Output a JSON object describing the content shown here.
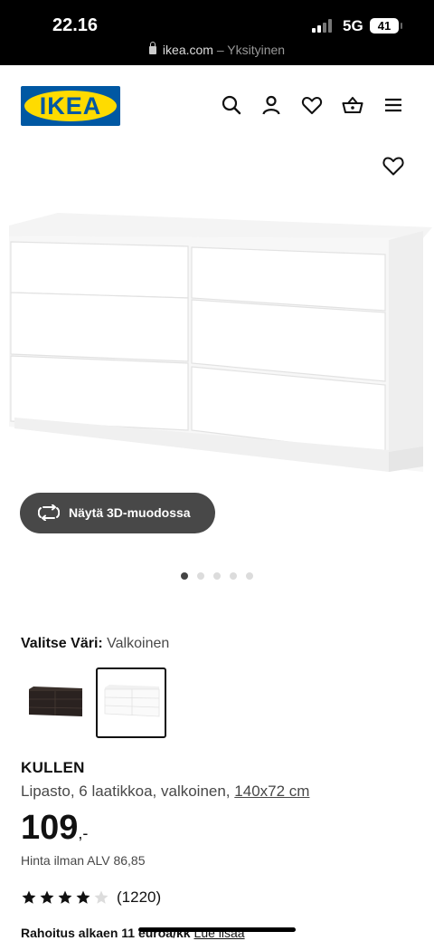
{
  "status_bar": {
    "time": "22.16",
    "network": "5G",
    "battery": "41",
    "url_domain": "ikea.com",
    "url_suffix": "– Yksityinen"
  },
  "header": {
    "logo_text": "IKEA",
    "brand_colors": {
      "blue": "#0058a3",
      "yellow": "#ffdb00"
    },
    "icons": [
      "search-icon",
      "account-icon",
      "favourites-icon",
      "cart-icon",
      "menu-icon"
    ]
  },
  "gallery": {
    "view_3d_label": "Näytä 3D-muodossa",
    "image_count": 5,
    "active_index": 0
  },
  "color_picker": {
    "label": "Valitse Väri:",
    "selected_value": "Valkoinen",
    "options": [
      "black-brown",
      "white"
    ],
    "selected_option": "white"
  },
  "product": {
    "name": "KULLEN",
    "description": "Lipasto, 6 laatikkoa, valkoinen,",
    "dimensions": "140x72 cm",
    "price": "109",
    "price_suffix": ",-",
    "price_excl_vat": "Hinta ilman ALV 86,85",
    "rating": 4,
    "rating_max": 5,
    "review_count": "(1220)",
    "financing_text": "Rahoitus alkaen 11 euroa/kk",
    "financing_link": "Lue lisää"
  }
}
